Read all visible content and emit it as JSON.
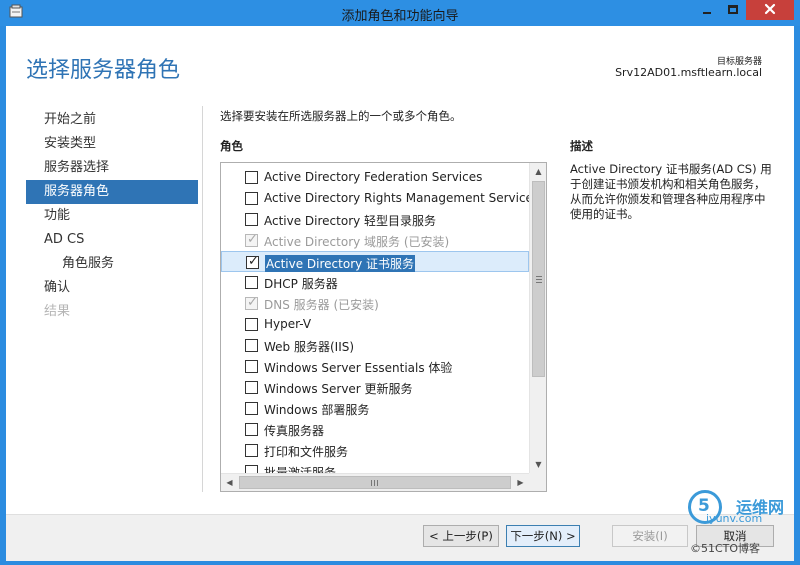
{
  "window": {
    "title": "添加角色和功能向导"
  },
  "header": {
    "title": "选择服务器角色",
    "target_label": "目标服务器",
    "target_value": "Srv12AD01.msftlearn.local"
  },
  "nav": {
    "items": [
      {
        "label": "开始之前",
        "state": "normal"
      },
      {
        "label": "安装类型",
        "state": "normal"
      },
      {
        "label": "服务器选择",
        "state": "normal"
      },
      {
        "label": "服务器角色",
        "state": "active"
      },
      {
        "label": "功能",
        "state": "normal"
      },
      {
        "label": "AD CS",
        "state": "normal"
      },
      {
        "label": "角色服务",
        "state": "sub"
      },
      {
        "label": "确认",
        "state": "normal"
      },
      {
        "label": "结果",
        "state": "disabled"
      }
    ]
  },
  "main": {
    "instruction": "选择要安装在所选服务器上的一个或多个角色。",
    "roles_header": "角色",
    "description_header": "描述",
    "description_text": "Active Directory 证书服务(AD CS) 用于创建证书颁发机构和相关角色服务，从而允许你颁发和管理各种应用程序中使用的证书。",
    "roles": [
      {
        "label": "Active Directory Federation Services",
        "checked": false,
        "disabled": false,
        "selected": false
      },
      {
        "label": "Active Directory Rights Management Services",
        "checked": false,
        "disabled": false,
        "selected": false
      },
      {
        "label": "Active Directory 轻型目录服务",
        "checked": false,
        "disabled": false,
        "selected": false
      },
      {
        "label": "Active Directory 域服务 (已安装)",
        "checked": true,
        "disabled": true,
        "selected": false
      },
      {
        "label": "Active Directory 证书服务",
        "checked": true,
        "disabled": false,
        "selected": true
      },
      {
        "label": "DHCP 服务器",
        "checked": false,
        "disabled": false,
        "selected": false
      },
      {
        "label": "DNS 服务器 (已安装)",
        "checked": true,
        "disabled": true,
        "selected": false
      },
      {
        "label": "Hyper-V",
        "checked": false,
        "disabled": false,
        "selected": false
      },
      {
        "label": "Web 服务器(IIS)",
        "checked": false,
        "disabled": false,
        "selected": false
      },
      {
        "label": "Windows Server Essentials 体验",
        "checked": false,
        "disabled": false,
        "selected": false
      },
      {
        "label": "Windows Server 更新服务",
        "checked": false,
        "disabled": false,
        "selected": false
      },
      {
        "label": "Windows 部署服务",
        "checked": false,
        "disabled": false,
        "selected": false
      },
      {
        "label": "传真服务器",
        "checked": false,
        "disabled": false,
        "selected": false
      },
      {
        "label": "打印和文件服务",
        "checked": false,
        "disabled": false,
        "selected": false
      },
      {
        "label": "批量激活服务",
        "checked": false,
        "disabled": false,
        "selected": false
      }
    ]
  },
  "footer": {
    "prev_label": "< 上一步(P)",
    "next_label": "下一步(N) >",
    "install_label": "安装(I)",
    "cancel_label": "取消"
  },
  "watermark": {
    "logo_text": "5",
    "text1": "运维网",
    "text2": "iyunv.com",
    "text3": "©51CTO博客"
  },
  "colors": {
    "titlebar": "#2d8fe3",
    "accent": "#2f74b5",
    "close": "#c7403b"
  }
}
